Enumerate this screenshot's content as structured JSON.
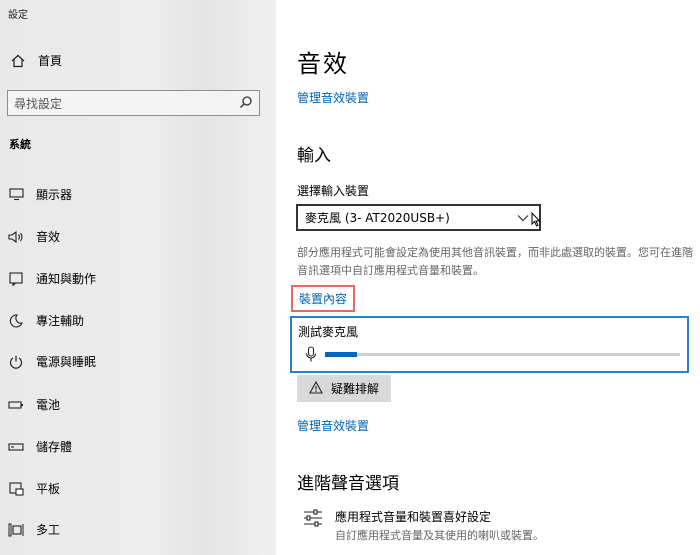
{
  "window": {
    "title": "設定"
  },
  "sidebar": {
    "home_label": "首頁",
    "search_placeholder": "尋找設定",
    "section_title": "系統",
    "items": [
      {
        "label": "顯示器",
        "icon": "monitor-icon"
      },
      {
        "label": "音效",
        "icon": "speaker-icon"
      },
      {
        "label": "通知與動作",
        "icon": "notification-icon"
      },
      {
        "label": "專注輔助",
        "icon": "moon-icon"
      },
      {
        "label": "電源與睡眠",
        "icon": "power-icon"
      },
      {
        "label": "電池",
        "icon": "battery-icon"
      },
      {
        "label": "儲存體",
        "icon": "storage-icon"
      },
      {
        "label": "平板",
        "icon": "tablet-icon"
      },
      {
        "label": "多工",
        "icon": "multitask-icon"
      }
    ]
  },
  "main": {
    "title": "音效",
    "manage_devices_link": "管理音效裝置",
    "input": {
      "heading": "輸入",
      "select_label": "選擇輸入裝置",
      "selected_device": "麥克風 (3- AT2020USB+)",
      "description": "部分應用程式可能會設定為使用其他音訊裝置，而非此處選取的裝置。您可在進階音訊選項中自訂應用程式音量和裝置。",
      "device_properties_link": "裝置內容",
      "test_label": "測試麥克風",
      "mic_level": 0.09,
      "troubleshoot_label": "疑難排解",
      "manage_devices_link": "管理音效裝置"
    },
    "advanced": {
      "heading": "進階聲音選項",
      "app_volume_title": "應用程式音量和裝置喜好設定",
      "app_volume_desc": "自訂應用程式音量及其使用的喇叭或裝置。"
    }
  },
  "colors": {
    "accent": "#0063b1",
    "highlight_border": "#e46a6a",
    "focus_border": "#2a7fce"
  }
}
